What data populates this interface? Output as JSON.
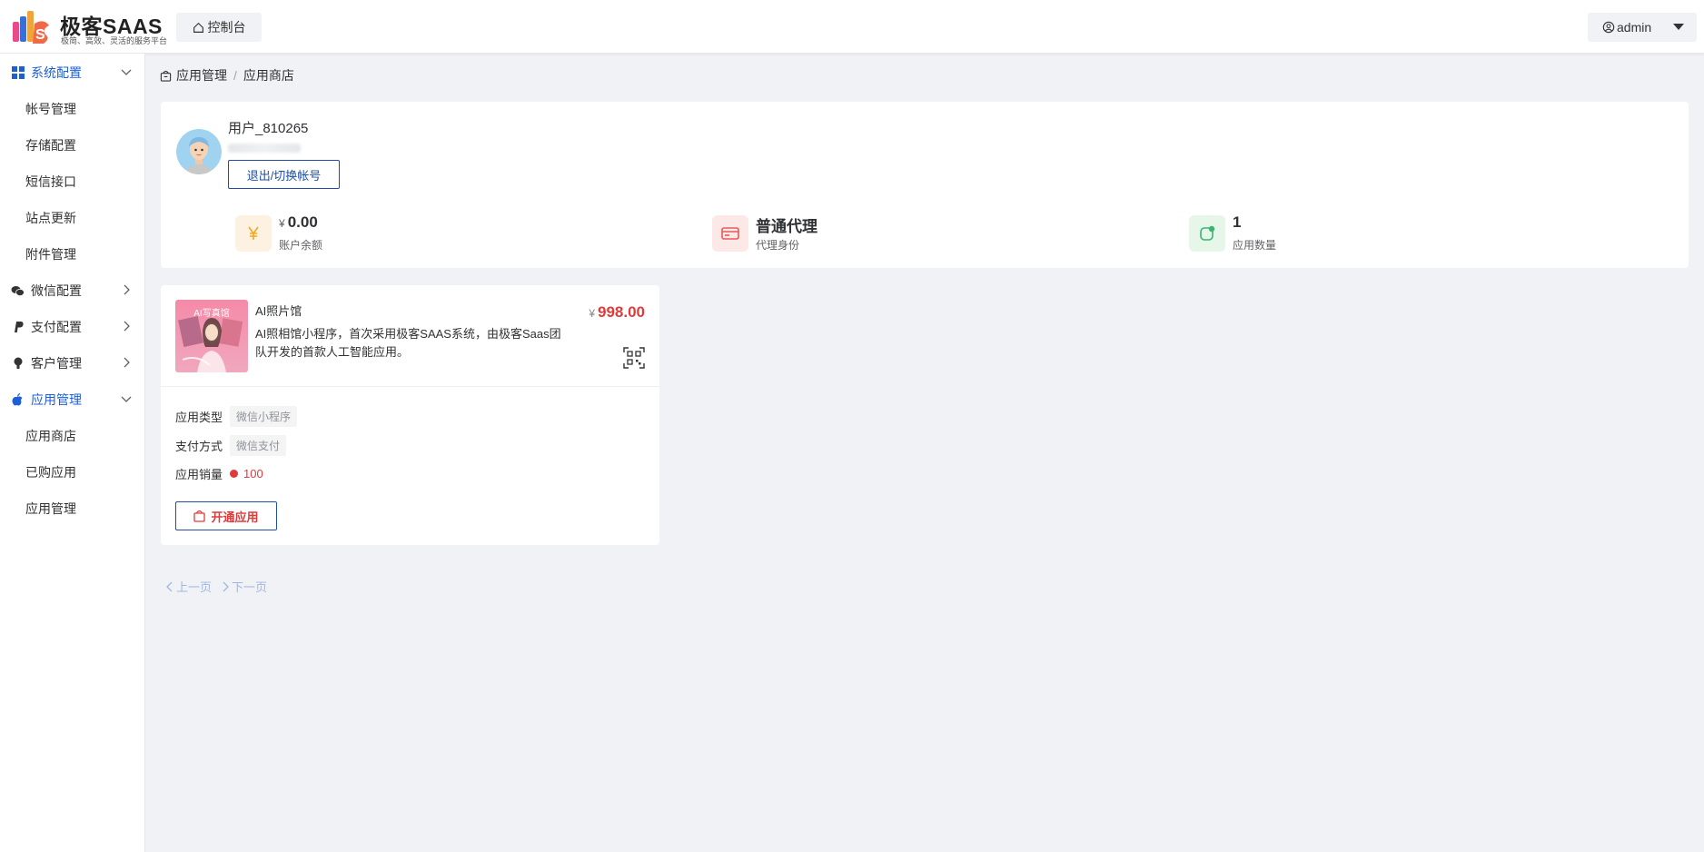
{
  "header": {
    "logo_title": "极客SAAS",
    "logo_subtitle": "极简、高效、灵活的服务平台",
    "console_label": "控制台",
    "user_label": "admin"
  },
  "sidebar": {
    "groups": [
      {
        "label": "系统配置",
        "icon": "grid-icon",
        "expanded": true,
        "active": true,
        "items": [
          "帐号管理",
          "存储配置",
          "短信接口",
          "站点更新",
          "附件管理"
        ]
      },
      {
        "label": "微信配置",
        "icon": "wechat-icon",
        "expanded": false
      },
      {
        "label": "支付配置",
        "icon": "paypal-icon",
        "expanded": false
      },
      {
        "label": "客户管理",
        "icon": "user-pin-icon",
        "expanded": false
      },
      {
        "label": "应用管理",
        "icon": "apple-icon",
        "expanded": true,
        "active": true,
        "items": [
          "应用商店",
          "已购应用",
          "应用管理"
        ]
      }
    ]
  },
  "breadcrumb": {
    "root": "应用管理",
    "current": "应用商店"
  },
  "profile": {
    "username": "用户_810265",
    "switch_label": "退出/切换帐号",
    "stats": [
      {
        "currency": "¥",
        "value": "0.00",
        "label": "账户余额",
        "icon": "yuan-icon",
        "color": "#f5a623"
      },
      {
        "value": "普通代理",
        "label": "代理身份",
        "icon": "card-icon",
        "color": "#e85a5a"
      },
      {
        "value": "1",
        "label": "应用数量",
        "icon": "app-count-icon",
        "color": "#3cb371"
      }
    ]
  },
  "apps": [
    {
      "name": "AI照片馆",
      "thumb_text": "AI写真馆",
      "description": "AI照相馆小程序，首次采用极客SAAS系统，由极客Saas团队开发的首款人工智能应用。",
      "currency": "¥",
      "price": "998.00",
      "type_label": "应用类型",
      "type_value": "微信小程序",
      "pay_label": "支付方式",
      "pay_value": "微信支付",
      "sales_label": "应用销量",
      "sales_value": "100",
      "open_label": "开通应用"
    }
  ],
  "pagination": {
    "prev": "上一页",
    "next": "下一页"
  }
}
